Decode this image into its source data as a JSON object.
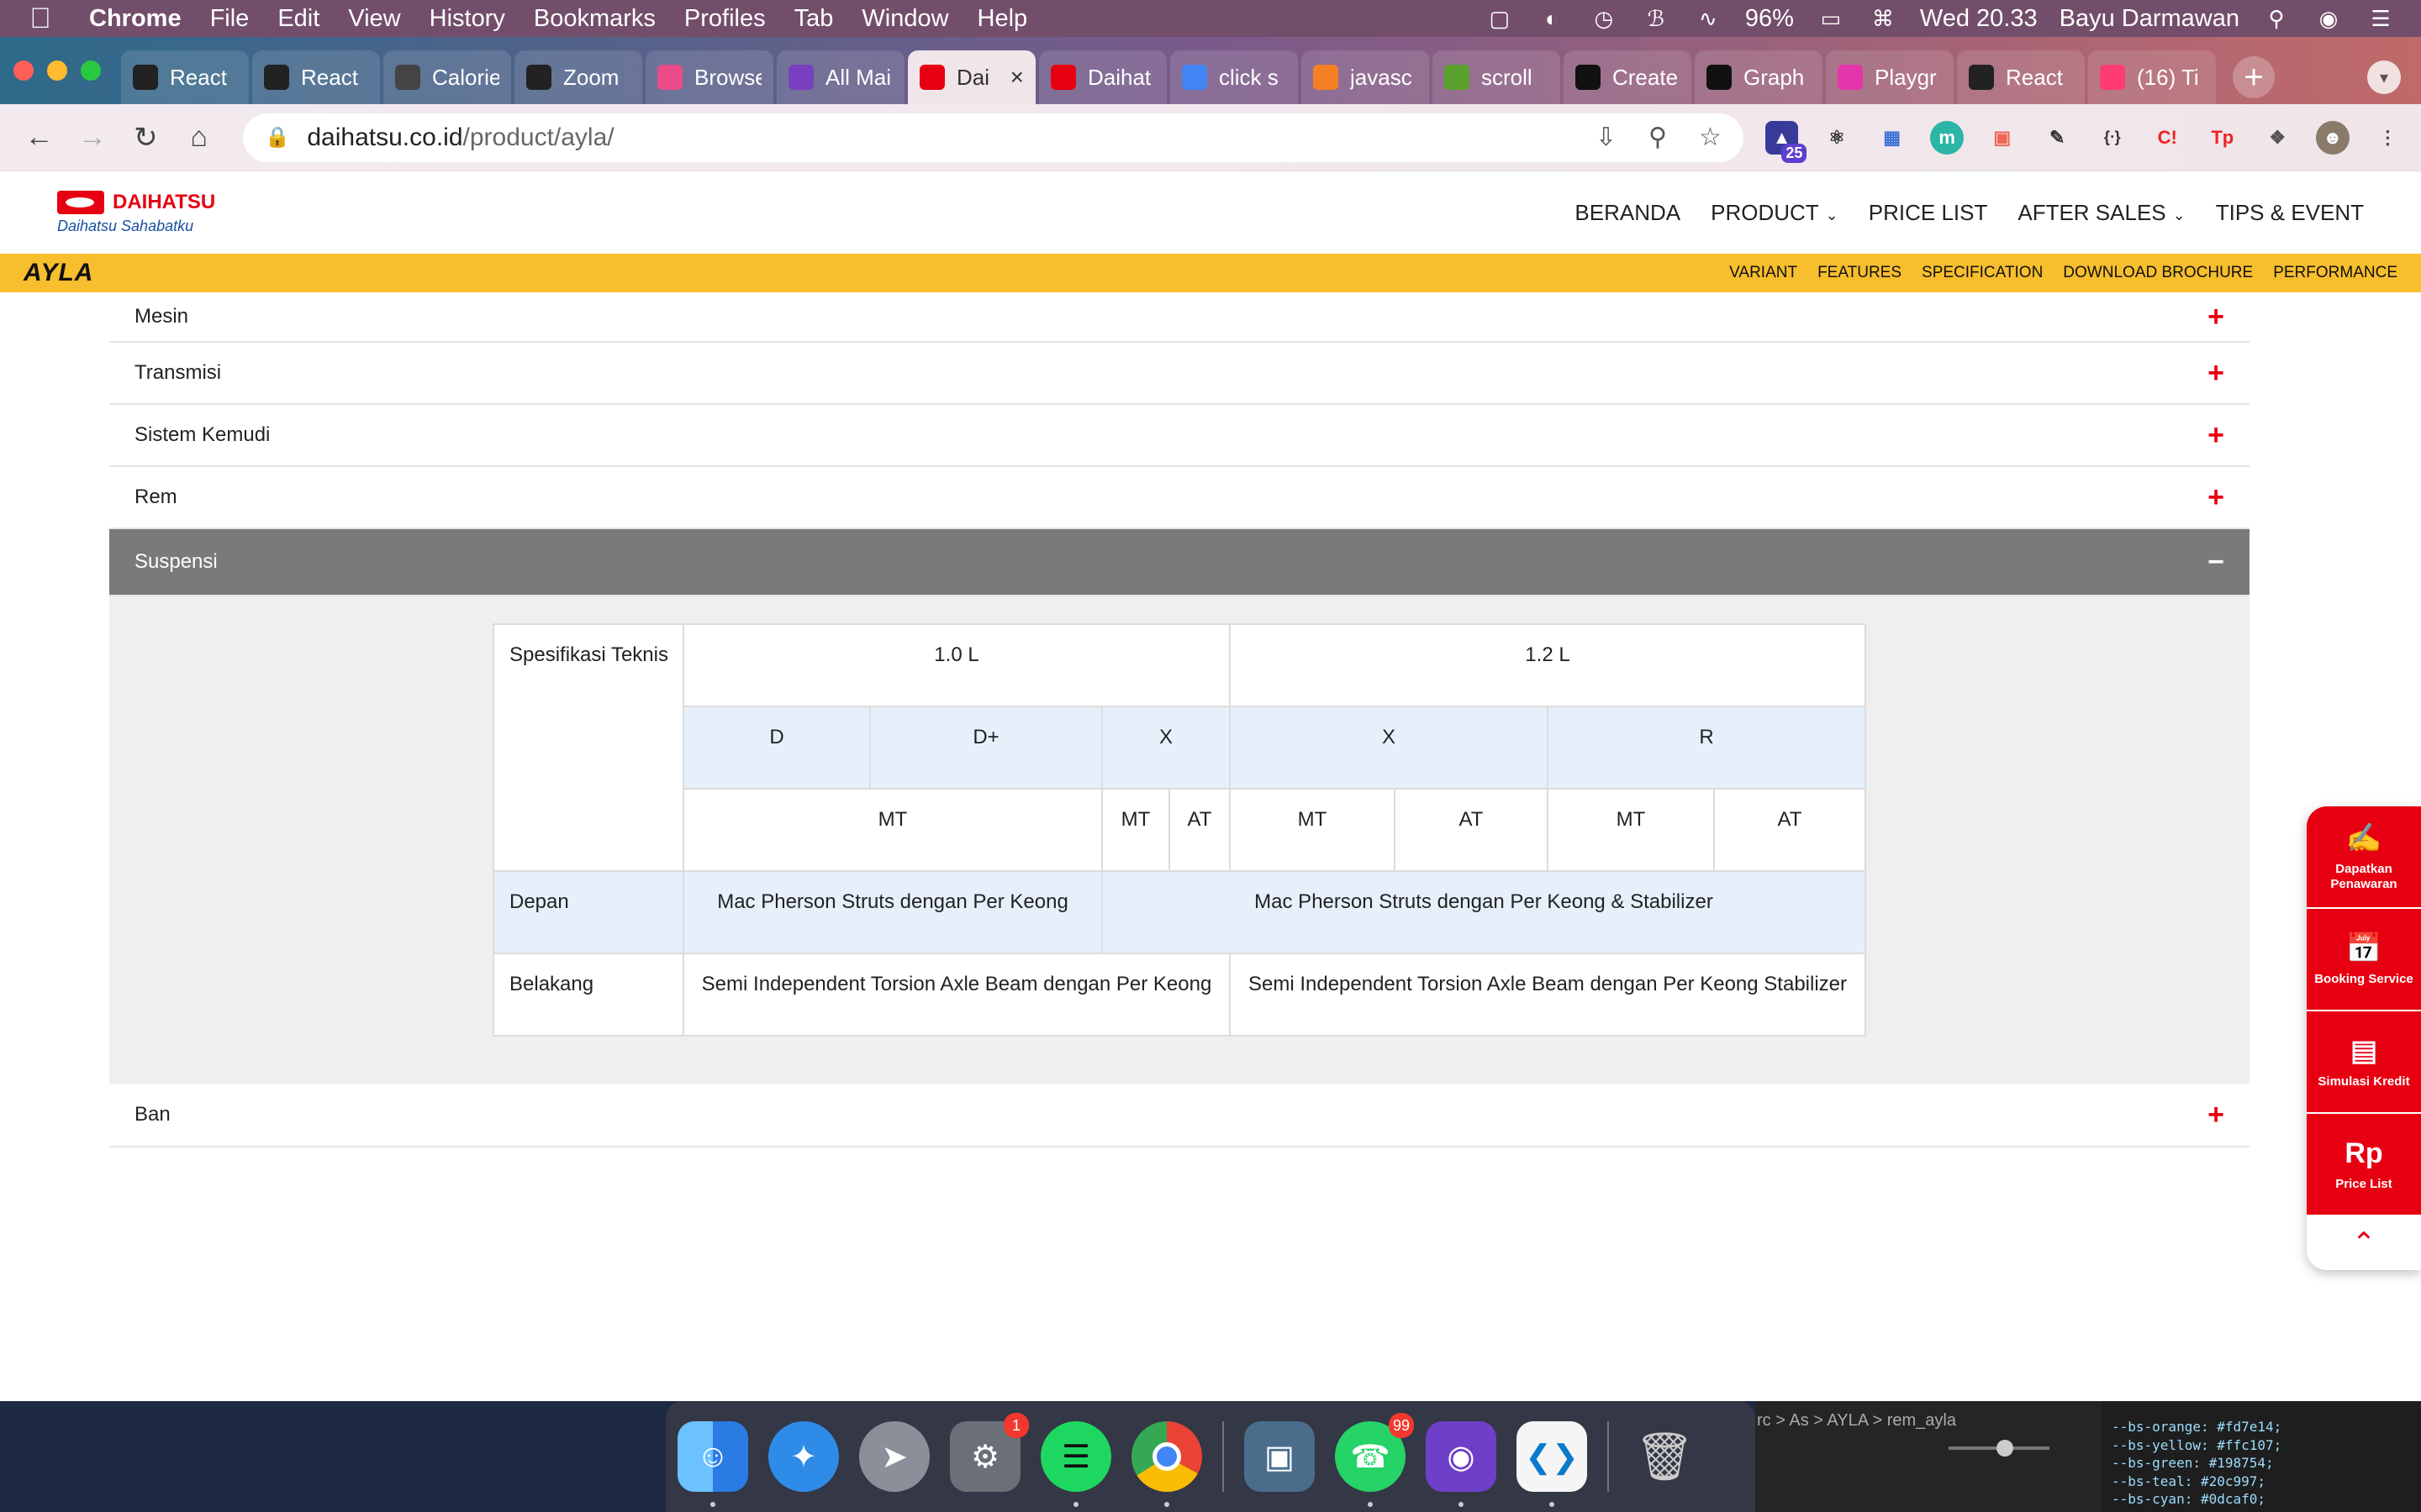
{
  "menubar": {
    "app": "Chrome",
    "items": [
      "File",
      "Edit",
      "View",
      "History",
      "Bookmarks",
      "Profiles",
      "Tab",
      "Window",
      "Help"
    ],
    "battery": "96%",
    "clock": "Wed 20.33",
    "user": "Bayu Darmawan"
  },
  "browser": {
    "tabs": [
      {
        "label": "React",
        "color": "#222"
      },
      {
        "label": "React",
        "color": "#222"
      },
      {
        "label": "Calorie",
        "color": "#444"
      },
      {
        "label": "Zoom",
        "color": "#222"
      },
      {
        "label": "Browse",
        "color": "#ea4c89"
      },
      {
        "label": "All Mai",
        "color": "#7a3fbf"
      },
      {
        "label": "Dai",
        "color": "#e60012",
        "active": true
      },
      {
        "label": "Daihat",
        "color": "#e60012"
      },
      {
        "label": "click s",
        "color": "#4285f4"
      },
      {
        "label": "javasc",
        "color": "#f48024"
      },
      {
        "label": "scroll",
        "color": "#5aa02c"
      },
      {
        "label": "Create",
        "color": "#111"
      },
      {
        "label": "Graph",
        "color": "#111"
      },
      {
        "label": "Playgr",
        "color": "#e535ab"
      },
      {
        "label": "React",
        "color": "#222"
      },
      {
        "label": "(16) Ti",
        "color": "#fe3c72"
      }
    ],
    "url_host": "daihatsu.co.id",
    "url_path": "/product/ayla/",
    "ext_badge": "25"
  },
  "site": {
    "brand": "DAIHATSU",
    "tagline": "Daihatsu Sahabatku",
    "nav": [
      "BERANDA",
      "PRODUCT",
      "PRICE LIST",
      "AFTER SALES",
      "TIPS & EVENT"
    ],
    "model_logo": "AYLA",
    "subnav": [
      "VARIANT",
      "FEATURES",
      "SPECIFICATION",
      "DOWNLOAD BROCHURE",
      "PERFORMANCE"
    ]
  },
  "accordion": {
    "mesin": "Mesin",
    "transmisi": "Transmisi",
    "sistem_kemudi": "Sistem Kemudi",
    "rem": "Rem",
    "suspensi": "Suspensi",
    "ban": "Ban"
  },
  "spec_table": {
    "header_label": "Spesifikasi Teknis",
    "engines": [
      "1.0 L",
      "1.2 L"
    ],
    "variants": [
      "D",
      "D+",
      "X",
      "X",
      "R"
    ],
    "transmissions": [
      "MT",
      "MT",
      "AT",
      "MT",
      "AT",
      "MT",
      "AT"
    ],
    "rows": [
      {
        "label": "Depan",
        "a": "Mac Pherson Struts dengan Per Keong",
        "b": "Mac Pherson Struts dengan Per Keong & Stabilizer"
      },
      {
        "label": "Belakang",
        "a": "Semi Independent Torsion Axle Beam dengan Per Keong",
        "b": "Semi Independent Torsion Axle Beam dengan Per Keong Stabilizer"
      }
    ]
  },
  "float_bar": {
    "items": [
      "Dapatkan Penawaran",
      "Booking Service",
      "Simulasi Kredit",
      "Price List"
    ],
    "rp": "Rp"
  },
  "dock": {
    "apps": [
      "Finder",
      "Safari",
      "Launchpad",
      "System Preferences",
      "Spotify",
      "Chrome",
      "Preview",
      "WhatsApp",
      "GitHub Desktop",
      "VS Code",
      "Trash"
    ],
    "badges": {
      "System Preferences": "1",
      "WhatsApp": "99"
    }
  },
  "peek": {
    "crumb": "rc > As > AYLA > rem_ayla",
    "code": [
      "--bs-orange: #fd7e14;",
      "--bs-yellow: #ffc107;",
      "--bs-green: #198754;",
      "--bs-teal: #20c997;",
      "--bs-cyan: #0dcaf0;"
    ]
  }
}
